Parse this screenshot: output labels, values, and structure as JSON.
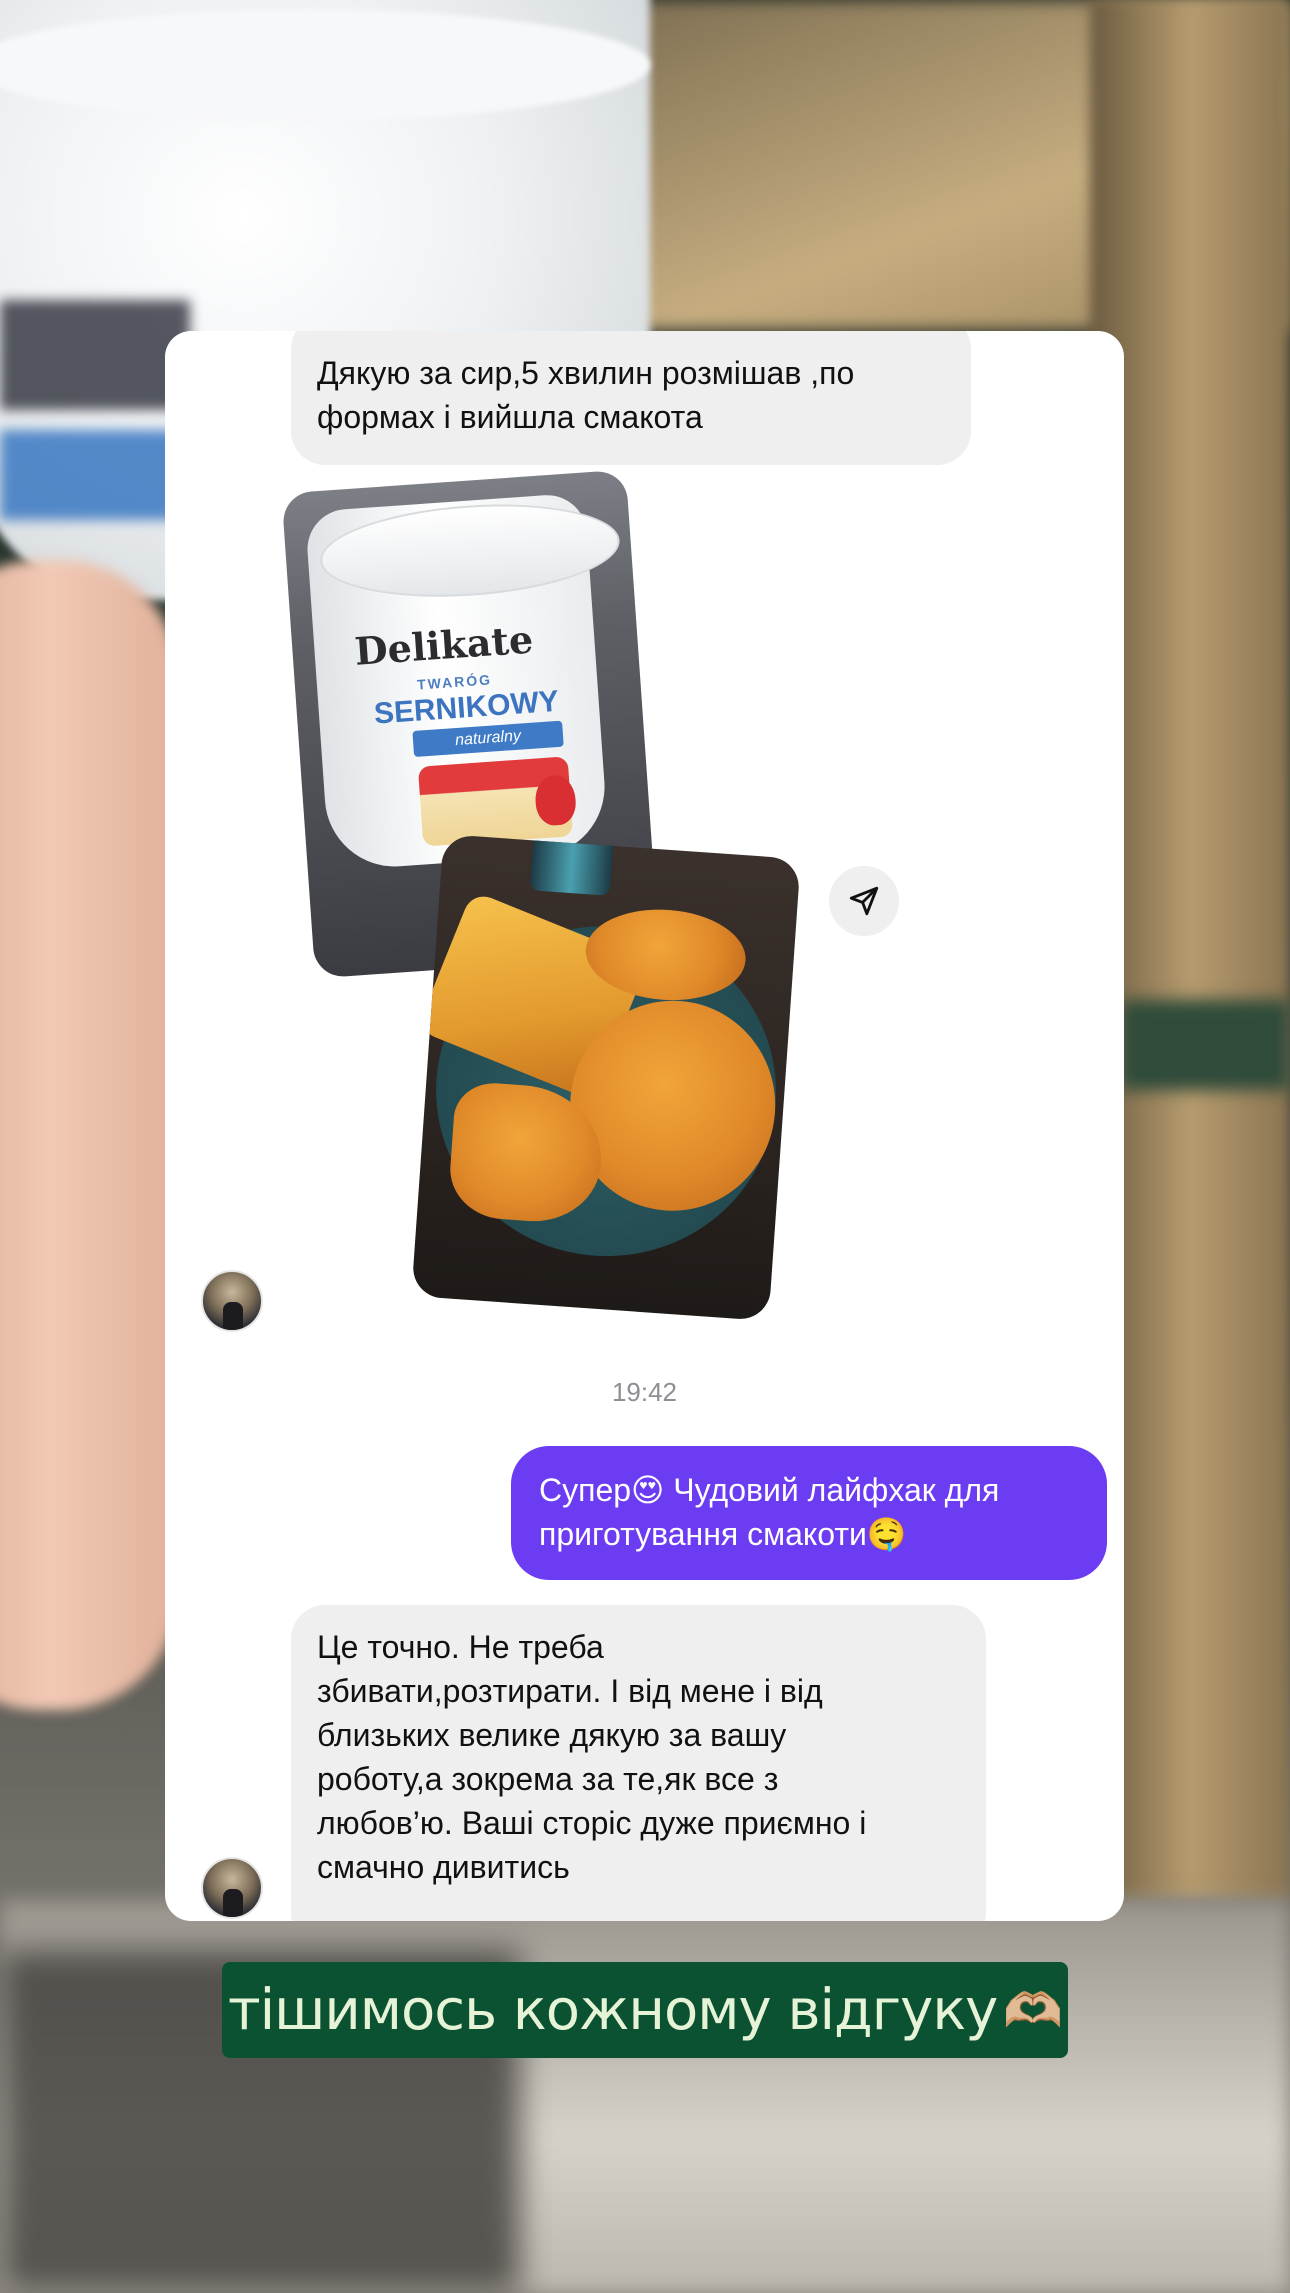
{
  "messages": {
    "incoming_1": "Дякую за сир,5 хвилин розмішав ,по\nформах і вийшла смакота",
    "timestamp": "19:42",
    "outgoing_1": "Супер😍 Чудовий лайфхак для\nприготування смакоти🤤",
    "incoming_2": "Це точно. Не треба\nзбивати,розтирати. І від мене і від\nблизьких велике дякую за вашу\nроботу,а зокрема за те,як все з\nлюбов’ю. Ваші сторіс дуже приємно і\nсмачно дивитись"
  },
  "photo_product": {
    "brand": "Delikate",
    "line1": "TWARÓG",
    "line2": "SERNIKOWY",
    "line3": "naturalny"
  },
  "caption": {
    "text": "тішимось кожному відгуку",
    "emoji": "🫶🏼"
  },
  "colors": {
    "outgoing_bubble": "#6b3cf2",
    "incoming_bubble": "#efeff0",
    "caption_bg": "#0b5232",
    "caption_text": "#e7f3d7"
  },
  "icons": {
    "share": "paper-plane-icon"
  }
}
